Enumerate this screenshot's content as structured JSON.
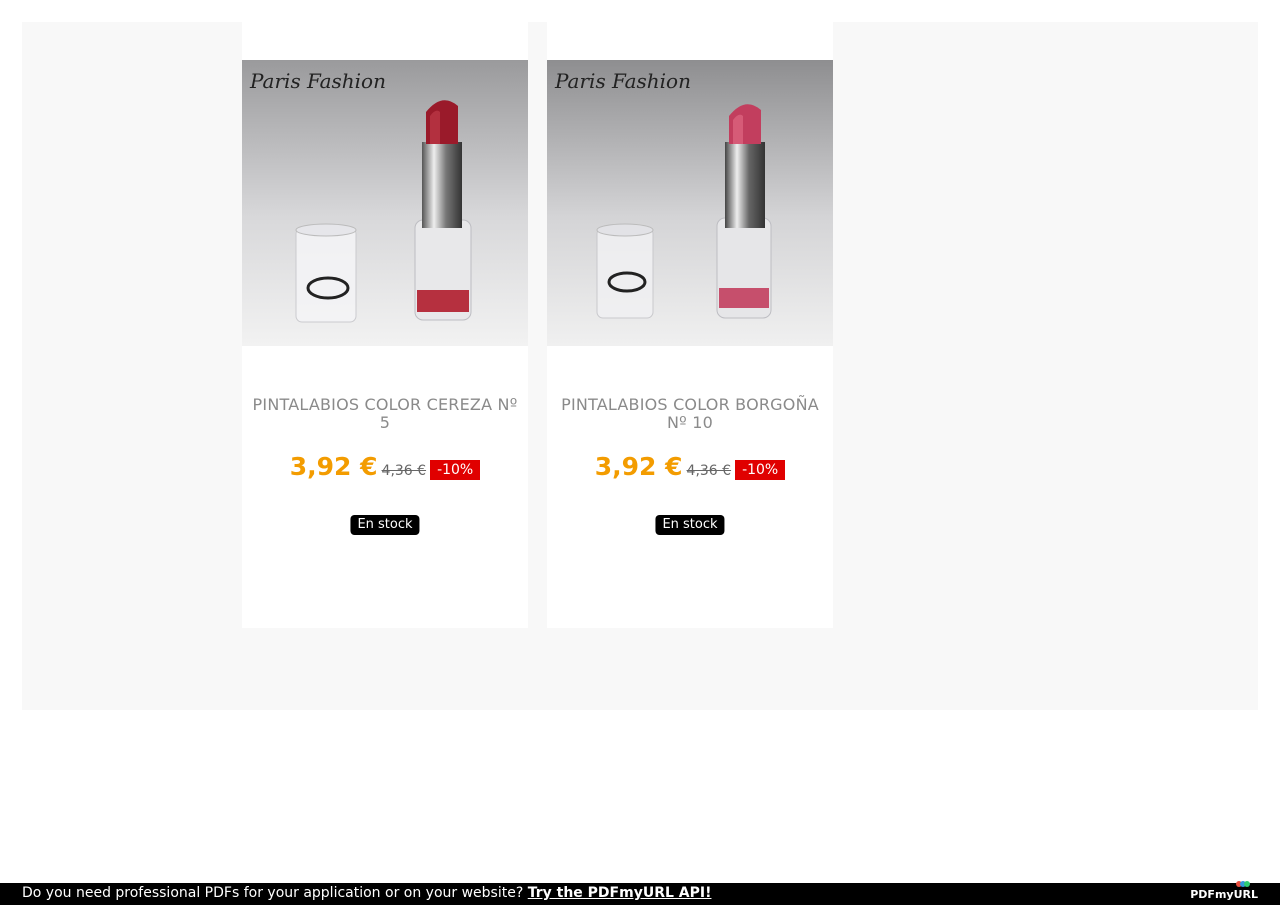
{
  "products": [
    {
      "name": "PINTALABIOS COLOR CEREZA Nº 5",
      "image_text": "Paris Fashion",
      "price": "3,92 €",
      "old_price": "4,36 €",
      "discount": "-10%",
      "stock": "En stock",
      "lipstick_color": "#9a1a2a"
    },
    {
      "name": "PINTALABIOS COLOR BORGOÑA Nº 10",
      "image_text": "Paris Fashion",
      "price": "3,92 €",
      "old_price": "4,36 €",
      "discount": "-10%",
      "stock": "En stock",
      "lipstick_color": "#c23e5e"
    }
  ],
  "footer": {
    "text": "Do you need professional PDFs for your application or on your website?",
    "link": "Try the PDFmyURL API!",
    "logo": "PDFmyURL"
  },
  "colors": {
    "price": "#f39c00",
    "discount_bg": "#e00000",
    "badge_bg": "#000000"
  }
}
